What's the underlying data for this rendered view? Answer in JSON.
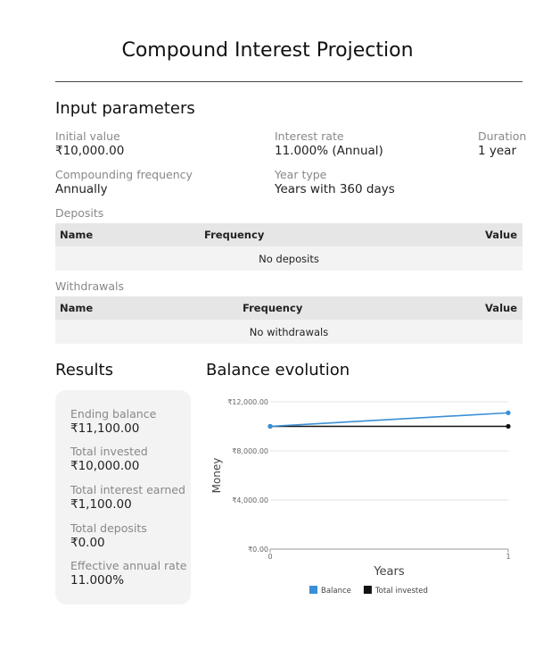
{
  "page_title": "Compound Interest Projection",
  "input_section": {
    "title": "Input parameters",
    "initial_value": {
      "label": "Initial value",
      "value": "₹10,000.00"
    },
    "interest_rate": {
      "label": "Interest rate",
      "value": "11.000% (Annual)"
    },
    "duration": {
      "label": "Duration",
      "value": "1 year"
    },
    "compounding": {
      "label": "Compounding frequency",
      "value": "Annually"
    },
    "year_type": {
      "label": "Year type",
      "value": "Years with 360 days"
    }
  },
  "deposits": {
    "label": "Deposits",
    "columns": [
      "Name",
      "Frequency",
      "Value"
    ],
    "empty_text": "No deposits"
  },
  "withdrawals": {
    "label": "Withdrawals",
    "columns": [
      "Name",
      "Frequency",
      "Value"
    ],
    "empty_text": "No withdrawals"
  },
  "results": {
    "title": "Results",
    "items": [
      {
        "label": "Ending balance",
        "value": "₹11,100.00"
      },
      {
        "label": "Total invested",
        "value": "₹10,000.00"
      },
      {
        "label": "Total interest earned",
        "value": "₹1,100.00"
      },
      {
        "label": "Total deposits",
        "value": "₹0.00"
      },
      {
        "label": "Effective annual rate",
        "value": "11.000%"
      }
    ]
  },
  "chart_data": {
    "type": "line",
    "title": "Balance evolution",
    "xlabel": "Years",
    "ylabel": "Money",
    "x": [
      0,
      1
    ],
    "x_ticks": [
      "0",
      "1"
    ],
    "ylim": [
      0,
      12000
    ],
    "y_ticks": [
      0,
      4000,
      8000,
      12000
    ],
    "y_tick_labels": [
      "₹0.00",
      "₹4,000.00",
      "₹8,000.00",
      "₹12,000.00"
    ],
    "grid": true,
    "legend_position": "bottom",
    "series": [
      {
        "name": "Balance",
        "color": "#3a8fd6",
        "values": [
          10000,
          11100
        ]
      },
      {
        "name": "Total invested",
        "color": "#111111",
        "values": [
          10000,
          10000
        ]
      }
    ]
  }
}
